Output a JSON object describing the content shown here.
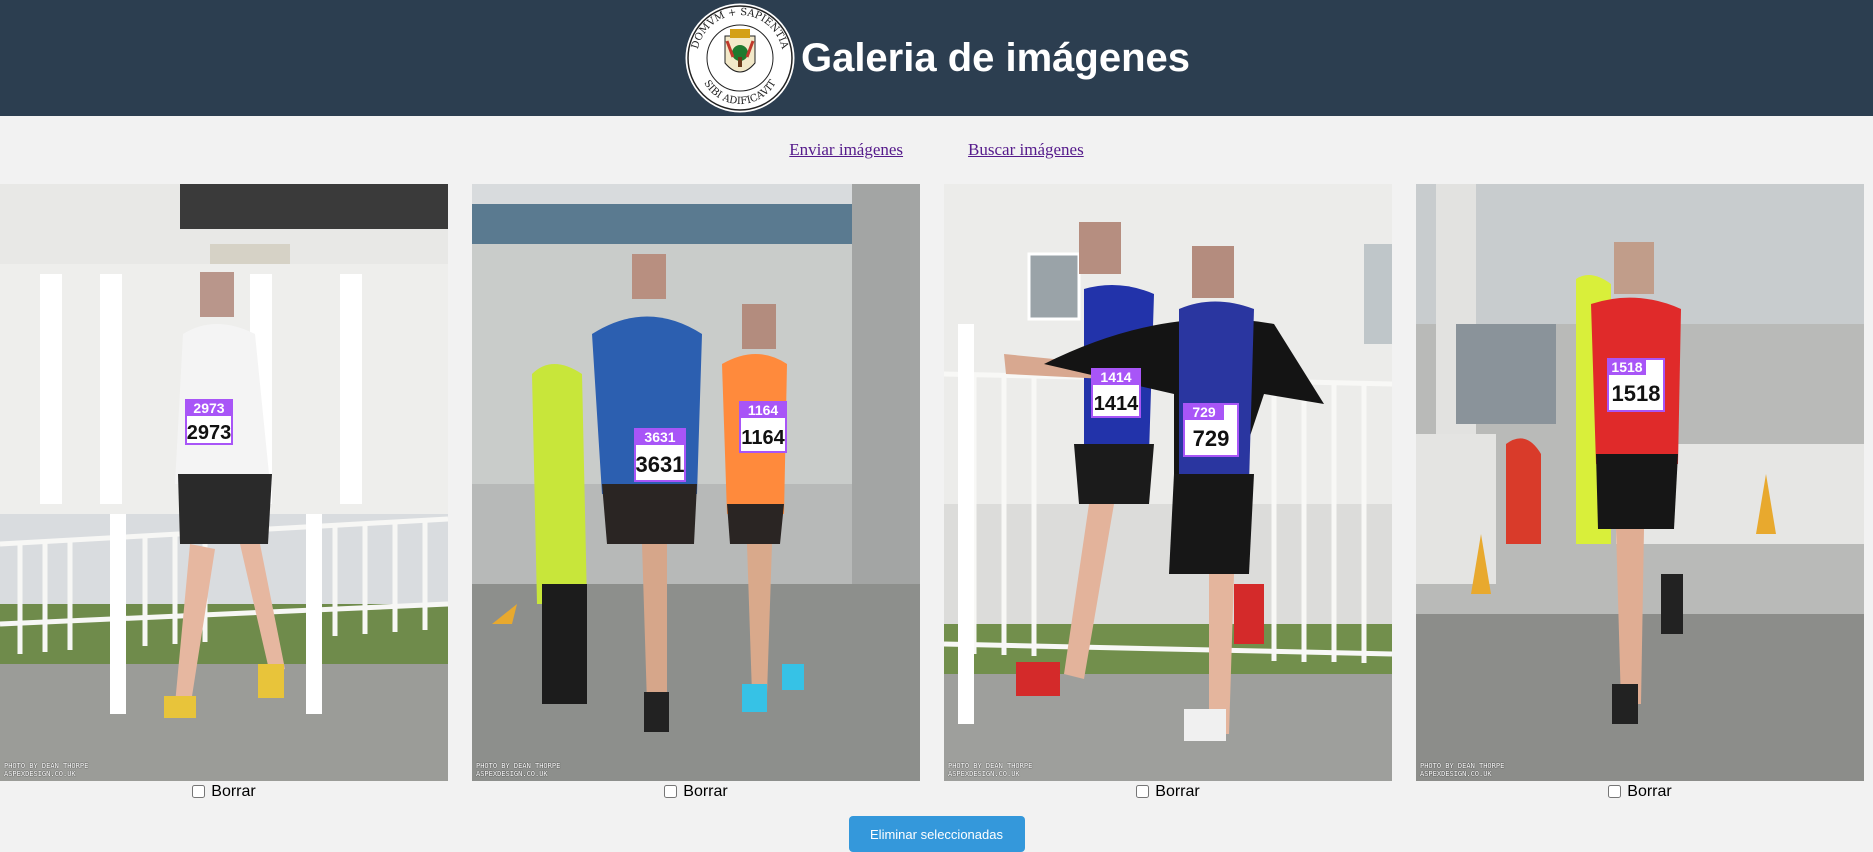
{
  "header": {
    "title": "Galeria de imágenes",
    "logo": {
      "icon": "university-seal-icon",
      "text_top": "DOMVM + SAPIENTIA",
      "text_bottom": "SIBI ADIFICAVIT"
    }
  },
  "nav": {
    "links": [
      {
        "label": "Enviar imágenes"
      },
      {
        "label": "Buscar imágenes"
      }
    ]
  },
  "gallery": {
    "items": [
      {
        "bibs": [
          "2973"
        ],
        "delete_label": "Borrar",
        "credit": "PHOTO BY DEAN THORPE\nASPEXDESIGN.CO.UK",
        "checked": false
      },
      {
        "bibs": [
          "3631",
          "1164"
        ],
        "delete_label": "Borrar",
        "credit": "PHOTO BY DEAN THORPE\nASPEXDESIGN.CO.UK",
        "checked": false
      },
      {
        "bibs": [
          "1414",
          "729"
        ],
        "delete_label": "Borrar",
        "credit": "PHOTO BY DEAN THORPE\nASPEXDESIGN.CO.UK",
        "checked": false
      },
      {
        "bibs": [
          "1518"
        ],
        "delete_label": "Borrar",
        "credit": "PHOTO BY DEAN THORPE\nASPEXDESIGN.CO.UK",
        "checked": false
      }
    ]
  },
  "actions": {
    "delete_selected_label": "Eliminar seleccionadas"
  },
  "colors": {
    "header_bg": "#2c3e50",
    "button_bg": "#3498db",
    "label_box": "#a855f7",
    "link": "#551a8b"
  }
}
